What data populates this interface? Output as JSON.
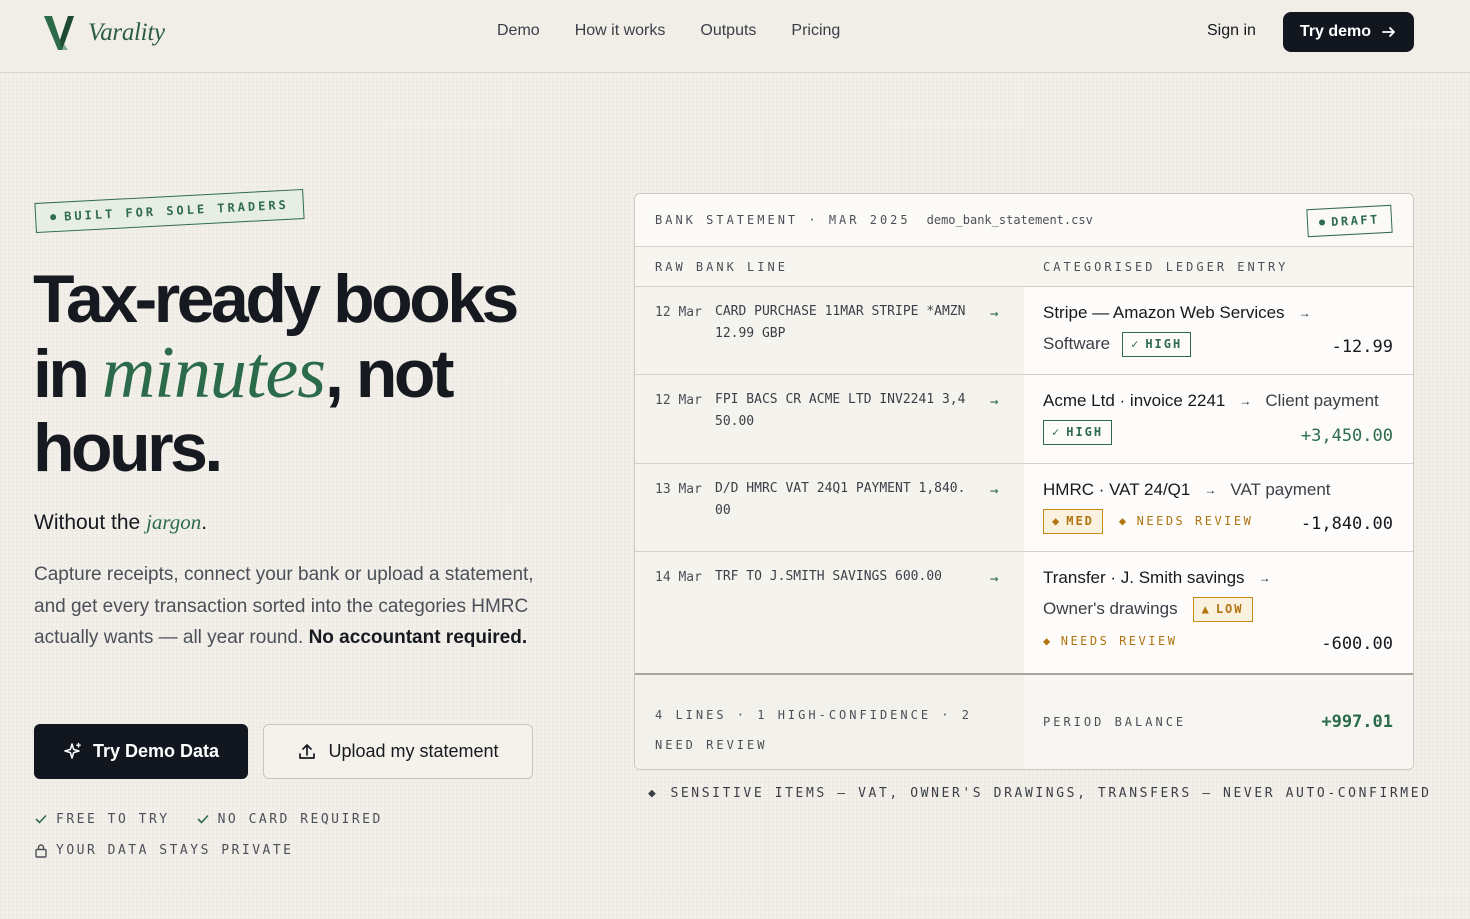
{
  "brand": {
    "name": "Varality",
    "accent": "#2b6b4a",
    "dark": "#12161f",
    "warning": "#b07410"
  },
  "nav": {
    "items": [
      "Demo",
      "How it works",
      "Outputs",
      "Pricing"
    ]
  },
  "header": {
    "signin": "Sign in",
    "try_demo": "Try demo"
  },
  "hero": {
    "badge": "BUILT FOR SOLE TRADERS",
    "title_l1": "Tax-ready books",
    "title_l2a": "in ",
    "title_l2_em": "minutes",
    "title_l2b": ", not",
    "title_l3": "hours.",
    "subtitle_a": "Without the ",
    "subtitle_em": "jargon",
    "subtitle_b": ".",
    "desc": "Capture receipts, connect your bank or upload a statement, and get every transaction sorted into the categories HMRC actually wants — all year round. ",
    "desc_strong": "No accountant required.",
    "btn_primary": "Try Demo Data",
    "btn_secondary": "Upload my statement",
    "perks": [
      "FREE TO TRY",
      "NO CARD REQUIRED",
      "YOUR DATA STAYS PRIVATE"
    ]
  },
  "ledger": {
    "title": "BANK STATEMENT · MAR 2025",
    "file": "demo_bank_statement.csv",
    "status": "DRAFT",
    "col_raw": "RAW BANK LINE",
    "col_entry": "CATEGORISED LEDGER ENTRY",
    "rows": [
      {
        "date": "12 Mar",
        "raw": "CARD PURCHASE 11MAR STRIPE *AMZN 12.99 GBP",
        "payee": "Stripe — Amazon Web Services",
        "category": "Software",
        "confidence": "HIGH",
        "review": "",
        "amount": "-12.99"
      },
      {
        "date": "12 Mar",
        "raw": "FPI BACS CR ACME LTD INV2241 3,450.00",
        "payee": "Acme Ltd · invoice 2241",
        "category": "Client payment",
        "confidence": "HIGH",
        "review": "",
        "amount": "+3,450.00"
      },
      {
        "date": "13 Mar",
        "raw": "D/D HMRC VAT 24Q1 PAYMENT 1,840.00",
        "payee": "HMRC · VAT 24/Q1",
        "category": "VAT payment",
        "confidence": "MED",
        "review": "NEEDS REVIEW",
        "amount": "-1,840.00"
      },
      {
        "date": "14 Mar",
        "raw": "TRF TO J.SMITH SAVINGS 600.00",
        "payee": "Transfer · J. Smith savings",
        "category": "Owner's drawings",
        "confidence": "LOW",
        "review": "NEEDS REVIEW",
        "amount": "-600.00"
      }
    ],
    "footer_summary": "4 LINES · 1 HIGH-CONFIDENCE · 2 NEED REVIEW",
    "period_label": "PERIOD BALANCE",
    "period_value": "+997.01",
    "note": "SENSITIVE ITEMS — VAT, OWNER'S DRAWINGS, TRANSFERS — NEVER AUTO-CONFIRMED"
  }
}
